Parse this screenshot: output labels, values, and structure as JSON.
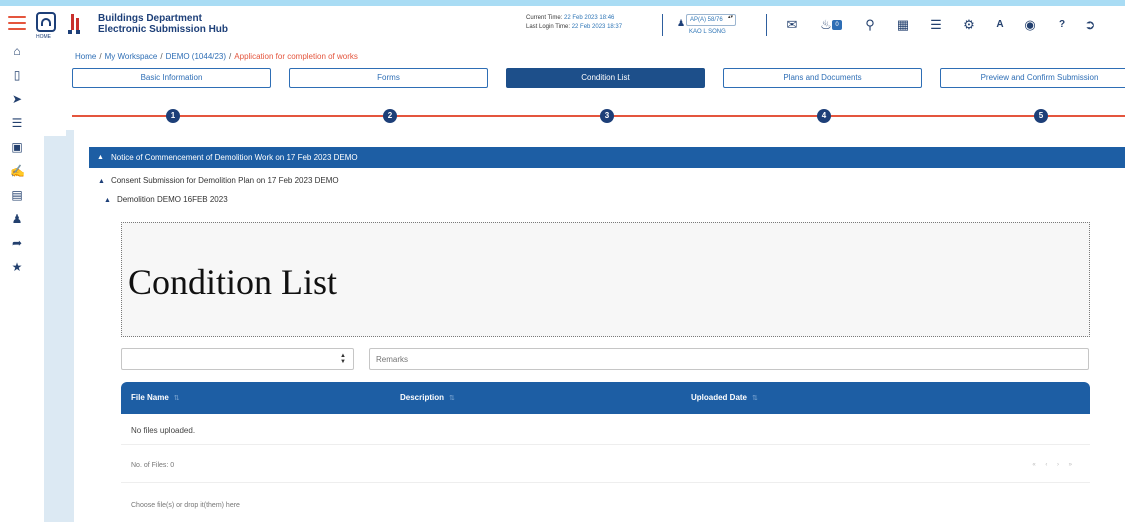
{
  "header": {
    "logo_caption": "HOME",
    "brand_line1": "Buildings Department",
    "brand_line2": "Electronic Submission Hub",
    "current_time_label": "Current Time:",
    "current_time": "22 Feb 2023 18:46",
    "last_login_label": "Last Login Time:",
    "last_login": "22 Feb 2023 18:37",
    "user_select": "AP(A) 58/76",
    "user_name": "KAO L SONG",
    "icons": [
      "mail-icon",
      "bell-icon",
      "search-icon",
      "calendar-icon",
      "list-icon",
      "gear-icon",
      "font-size-icon",
      "globe-icon",
      "help-icon",
      "logout-icon"
    ],
    "notification_count": "0"
  },
  "sidebar": {
    "icons": [
      "home-icon",
      "inbox-icon",
      "send-icon",
      "network-icon",
      "briefcase-icon",
      "handshake-icon",
      "card-icon",
      "user-icon",
      "share-icon",
      "star-icon"
    ]
  },
  "breadcrumb": {
    "home": "Home",
    "workspace": "My Workspace",
    "demo": "DEMO (1044/23)",
    "current": "Application for completion of works"
  },
  "steps": [
    {
      "label": "Basic Information",
      "num": "1"
    },
    {
      "label": "Forms",
      "num": "2"
    },
    {
      "label": "Condition List",
      "num": "3"
    },
    {
      "label": "Plans and Documents",
      "num": "4"
    },
    {
      "label": "Preview and Confirm Submission",
      "num": "5"
    }
  ],
  "accordion": {
    "level1": "Notice of Commencement of Demolition Work on 17 Feb 2023 DEMO",
    "level2": "Consent Submission for Demolition Plan on 17 Feb 2023 DEMO",
    "level3": "Demolition DEMO 16FEB 2023"
  },
  "condition_list_title": "Condition List",
  "remarks_placeholder": "Remarks",
  "table": {
    "columns": [
      "File Name",
      "Description",
      "Uploaded Date"
    ],
    "empty_text": "No files uploaded.",
    "count_text": "No. of Files: 0",
    "drop_text": "Choose file(s) or drop it(them) here"
  },
  "colors": {
    "primary": "#1d5ea4",
    "accent": "#e4553d",
    "link": "#2e6eb5"
  }
}
